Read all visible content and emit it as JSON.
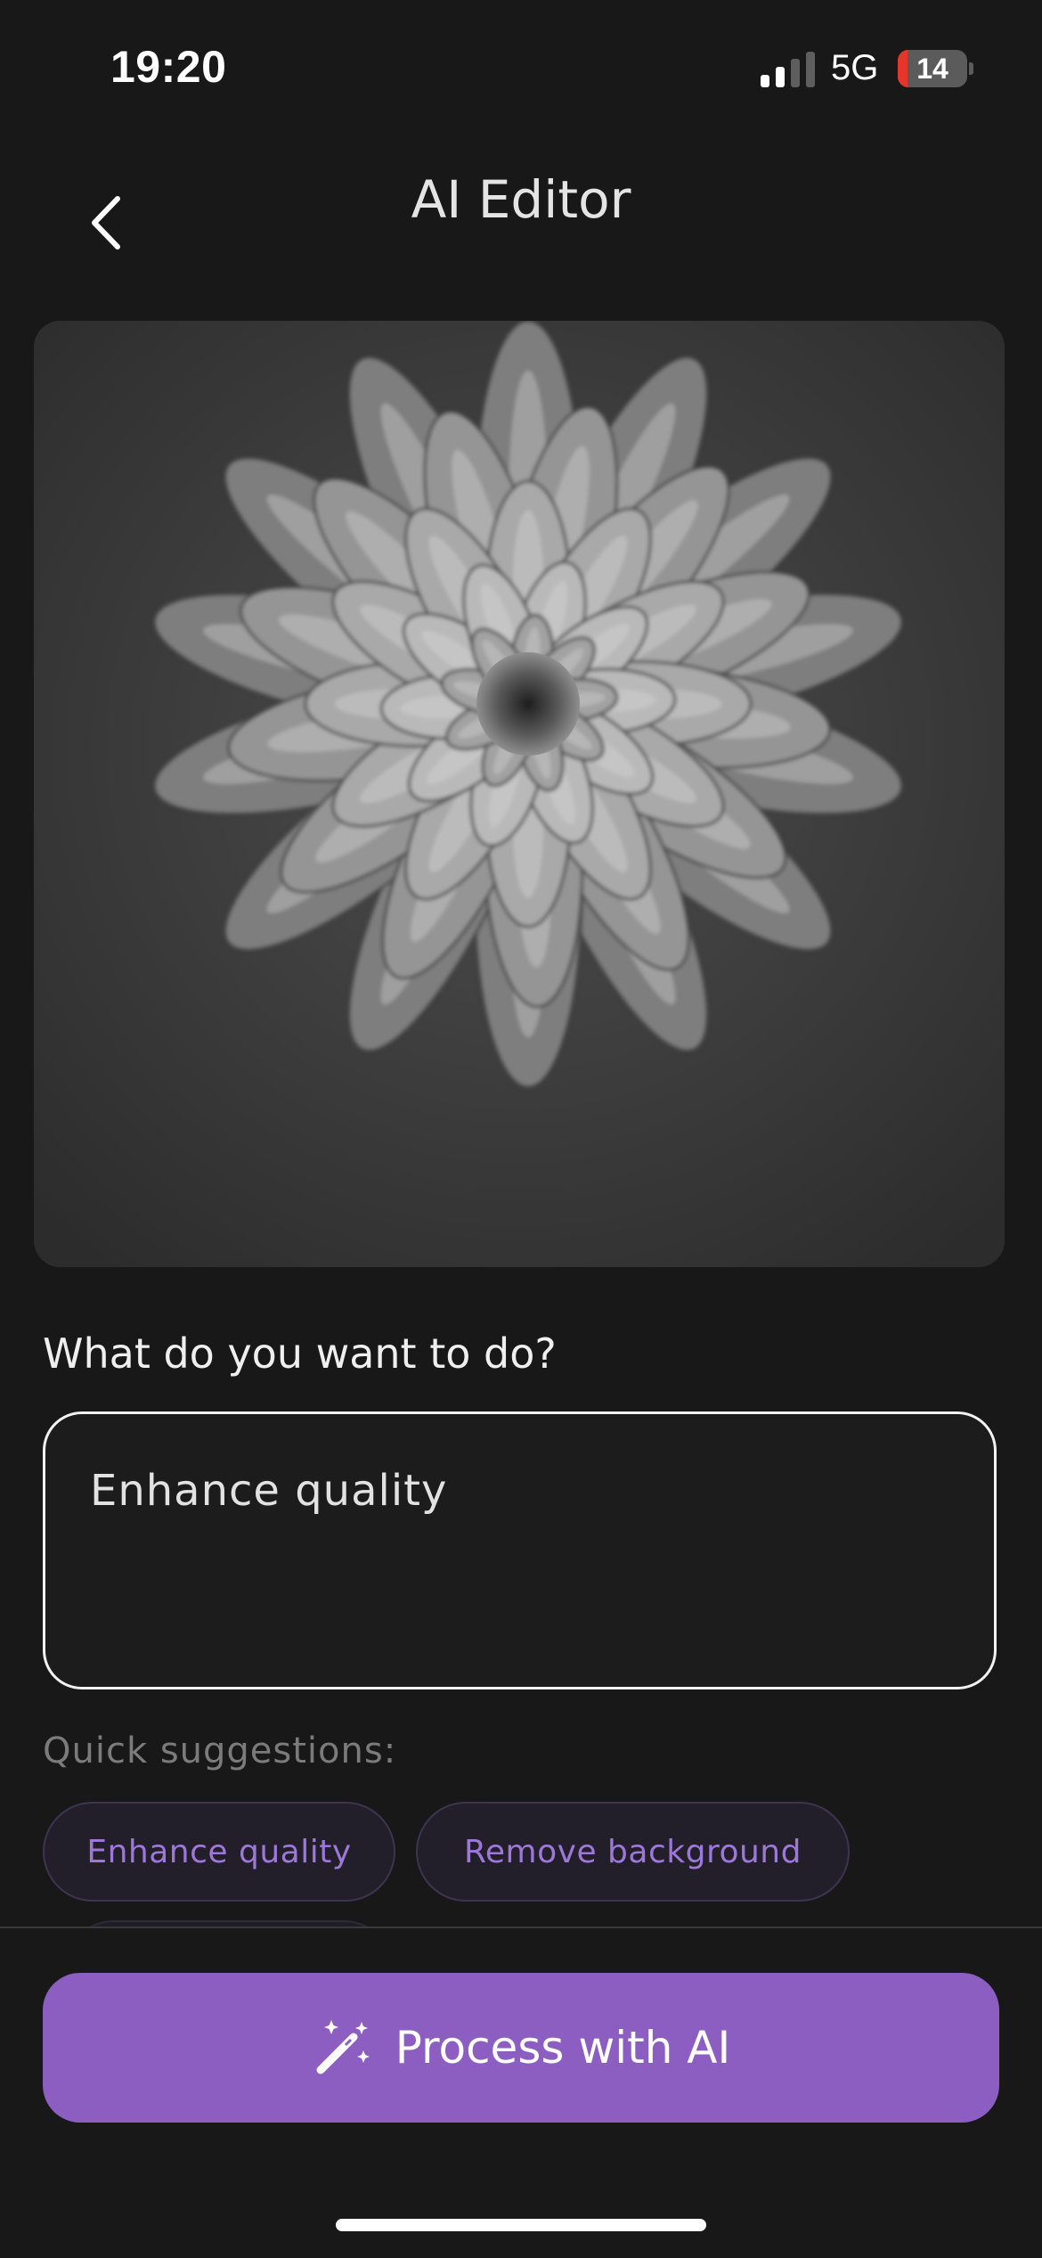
{
  "status_bar": {
    "time": "19:20",
    "network": "5G",
    "battery_level": "14",
    "battery_fraction": 0.14,
    "icons": [
      "signal-bars-icon",
      "battery-icon"
    ]
  },
  "header": {
    "title": "AI Editor",
    "back_icon": "chevron-left-icon"
  },
  "preview": {
    "subject": "black and white dahlia photo"
  },
  "prompt": {
    "heading": "What do you want to do?",
    "value": "Enhance quality"
  },
  "suggestions": {
    "label": "Quick suggestions:",
    "chips": [
      "Enhance quality",
      "Remove background"
    ]
  },
  "action": {
    "label": "Process with AI",
    "icon": "magic-wand-icon"
  },
  "colors": {
    "background": "#181818",
    "accent": "#8c5ec2",
    "chip_text": "#9d78d8",
    "battery_low": "#e5352c"
  }
}
